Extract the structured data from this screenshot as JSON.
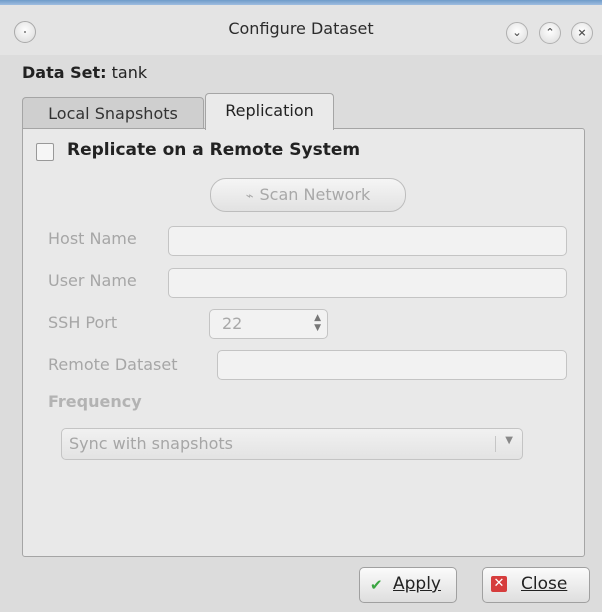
{
  "window": {
    "title": "Configure Dataset"
  },
  "dataset": {
    "label": "Data Set:",
    "value": "tank"
  },
  "tabs": [
    {
      "label": "Local Snapshots"
    },
    {
      "label": "Replication"
    }
  ],
  "replication": {
    "checkbox_label": "Replicate on a Remote System",
    "checked": false,
    "scan_button": "Scan Network",
    "host_label": "Host Name",
    "host_value": "",
    "user_label": "User Name",
    "user_value": "",
    "port_label": "SSH Port",
    "port_value": "22",
    "remote_label": "Remote Dataset",
    "remote_value": "",
    "frequency_label": "Frequency",
    "frequency_value": "Sync with snapshots"
  },
  "buttons": {
    "apply": "Apply",
    "close": "Close"
  },
  "icons": {
    "window_menu": "circle-menu-icon",
    "minimize": "chevron-down-icon",
    "maximize": "chevron-up-icon",
    "close_window": "close-x-icon",
    "scan": "wifi-antenna-icon",
    "apply": "checkmark-icon",
    "close": "x-box-icon"
  },
  "colors": {
    "apply_icon": "#3aa541",
    "close_icon": "#d63d3d",
    "disabled_text": "#a6a6a6"
  }
}
